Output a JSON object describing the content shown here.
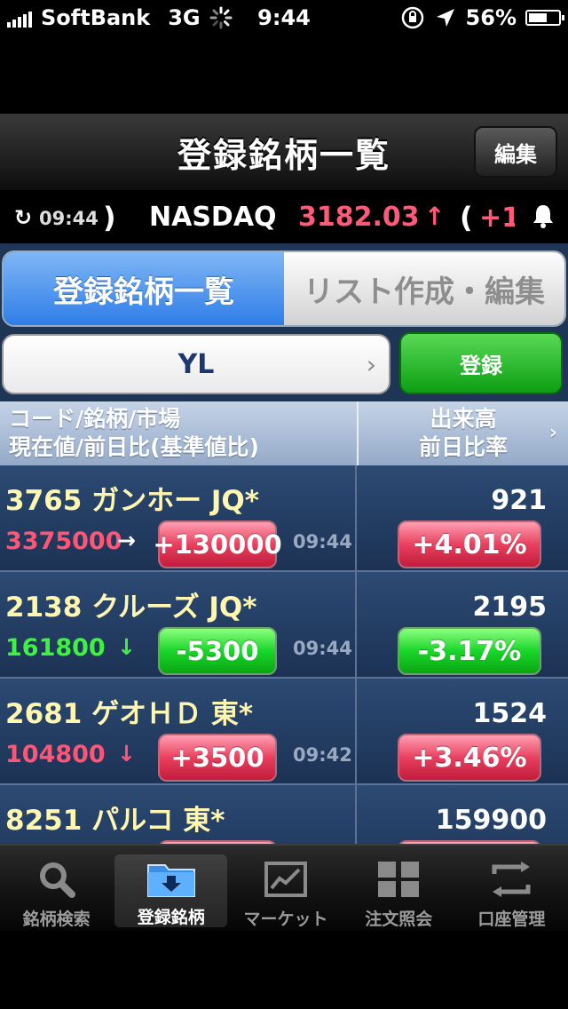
{
  "status_bar": {
    "carrier": "SoftBank",
    "network": "3G",
    "time": "9:44",
    "battery": "56%"
  },
  "nav": {
    "title": "登録銘柄一覧",
    "edit_label": "編集"
  },
  "ticker": {
    "time": "09:44",
    "open_paren": ")",
    "index_name": "NASDAQ",
    "index_value": "3182.03",
    "direction": "↑",
    "paren2": "(",
    "change_partial": "+1"
  },
  "segments": {
    "tab1": "登録銘柄一覧",
    "tab2": "リスト作成・編集"
  },
  "list_selector": {
    "name": "YL",
    "register_label": "登録"
  },
  "table_header": {
    "left_line1": "コード/銘柄/市場",
    "left_line2": "現在値/前日比(基準値比)",
    "right_line1": "出来高",
    "right_line2": "前日比率"
  },
  "rows": [
    {
      "title": "3765  ガンホー JQ*",
      "price": "3375000",
      "price_arrow": "→",
      "price_color": "#ff5576",
      "change": "+130000",
      "change_dir": "up",
      "time": "09:44",
      "volume": "921",
      "pct": "+4.01%",
      "pct_dir": "up"
    },
    {
      "title": "2138  クルーズ JQ*",
      "price": "161800",
      "price_arrow": "↓",
      "price_color": "#3ff23f",
      "change": "-5300",
      "change_dir": "down",
      "time": "09:44",
      "volume": "2195",
      "pct": "-3.17%",
      "pct_dir": "down"
    },
    {
      "title": "2681  ゲオＨＤ 東*",
      "price": "104800",
      "price_arrow": "↓",
      "price_color": "#ff5576",
      "change": "+3500",
      "change_dir": "up",
      "time": "09:42",
      "volume": "1524",
      "pct": "+3.46%",
      "pct_dir": "up"
    },
    {
      "title": "8251  パルコ 東*",
      "price": "",
      "price_arrow": "",
      "price_color": "#ff5576",
      "change": "",
      "change_dir": "up",
      "time": "",
      "volume": "159900",
      "pct": "",
      "pct_dir": "up"
    }
  ],
  "tabbar": [
    {
      "label": "銘柄検索",
      "icon": "search-icon"
    },
    {
      "label": "登録銘柄",
      "icon": "folder-download-icon"
    },
    {
      "label": "マーケット",
      "icon": "chart-icon"
    },
    {
      "label": "注文照会",
      "icon": "grid-icon"
    },
    {
      "label": "口座管理",
      "icon": "transfer-icon"
    }
  ]
}
